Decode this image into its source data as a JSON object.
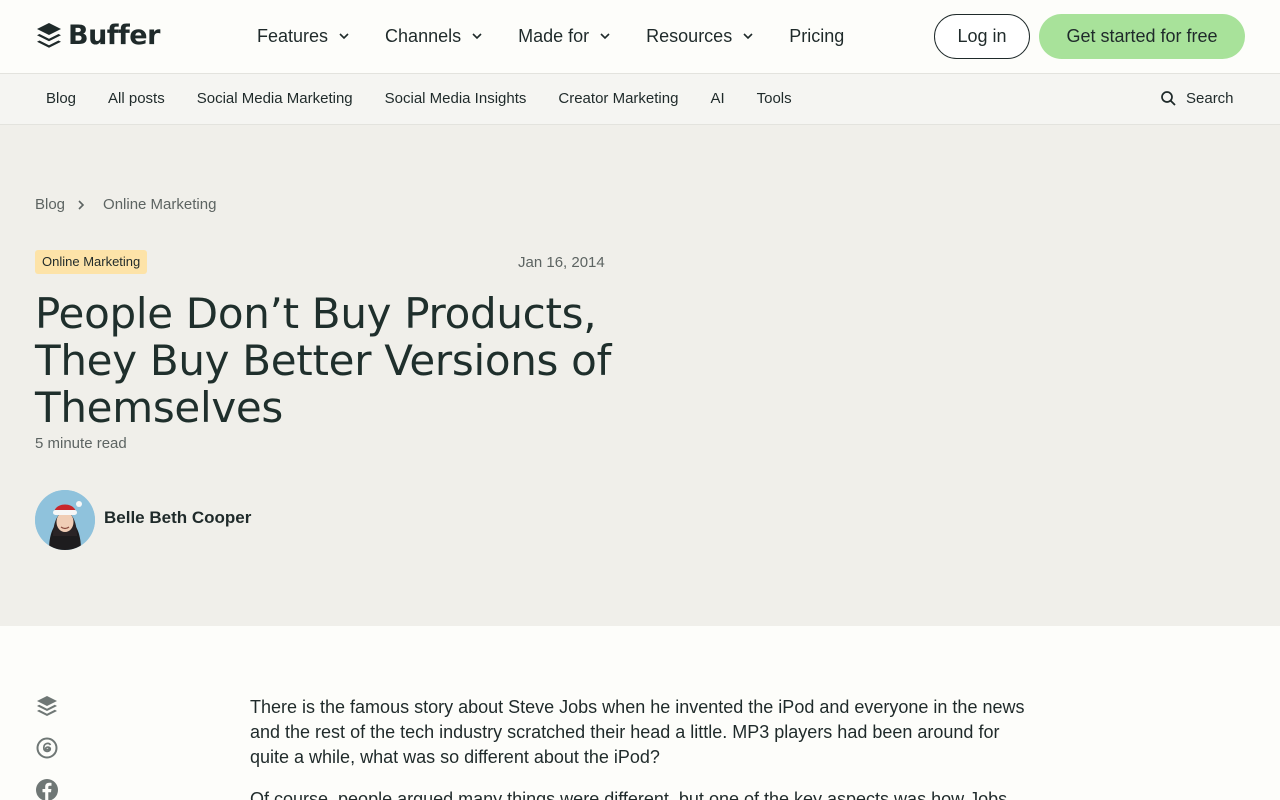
{
  "brand": {
    "name": "Buffer",
    "logo_icon": "buffer-stack-icon",
    "accent": "#a8e29a"
  },
  "topnav": {
    "menu": [
      {
        "label": "Features",
        "has_dropdown": true
      },
      {
        "label": "Channels",
        "has_dropdown": true
      },
      {
        "label": "Made for",
        "has_dropdown": true
      },
      {
        "label": "Resources",
        "has_dropdown": true
      },
      {
        "label": "Pricing",
        "has_dropdown": false
      }
    ],
    "login_label": "Log in",
    "cta_label": "Get started for free"
  },
  "subnav": {
    "links": [
      "Blog",
      "All posts",
      "Social Media Marketing",
      "Social Media Insights",
      "Creator Marketing",
      "AI",
      "Tools"
    ],
    "search_label": "Search"
  },
  "hero": {
    "breadcrumb": [
      "Blog",
      "Online Marketing"
    ],
    "tag": "Online Marketing",
    "date": "Jan 16, 2014",
    "title": "People Don’t Buy Products, They Buy Better Versions of Themselves",
    "read_time": "5 minute read",
    "author": "Belle Beth Cooper"
  },
  "share_icons": [
    "buffer-icon",
    "threads-icon",
    "facebook-icon"
  ],
  "article": {
    "paragraphs": [
      "There is the famous story about Steve Jobs when he invented the iPod and everyone in the news and the rest of the tech industry scratched their head a little. MP3 players had been around for quite a while, what was so different about the iPod?",
      "Of course, people argued many things were different, but one of the key aspects was how Jobs"
    ]
  }
}
